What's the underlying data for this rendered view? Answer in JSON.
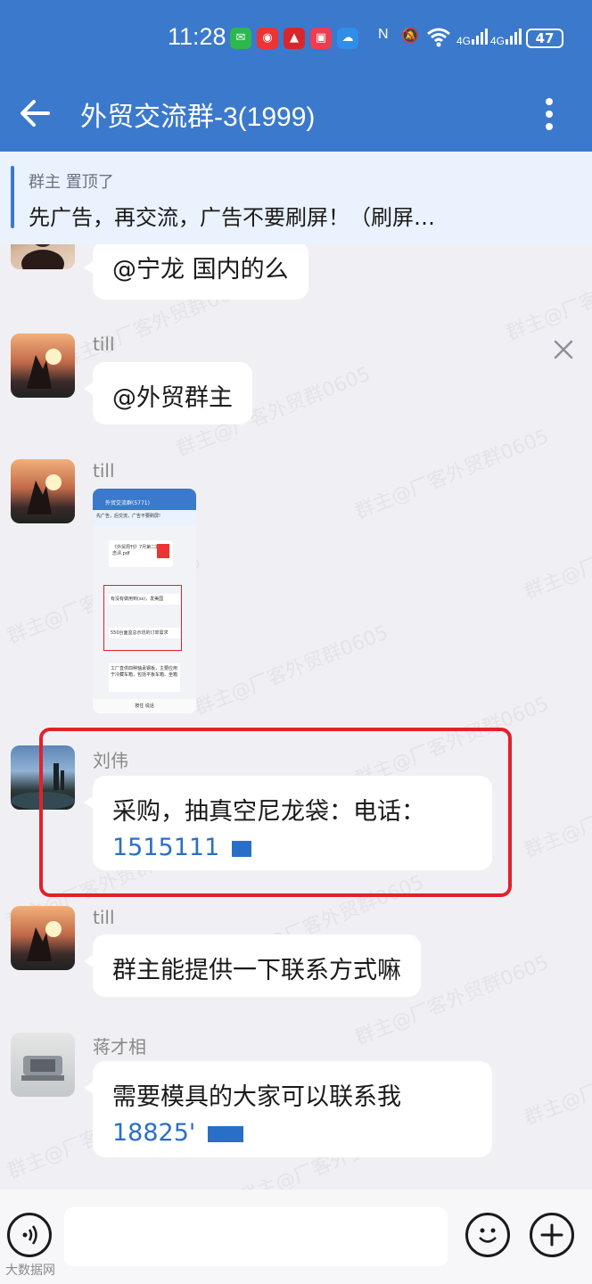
{
  "status_bar": {
    "time": "11:28",
    "battery": "47",
    "network_1": "4G",
    "network_2": "4G"
  },
  "header": {
    "title": "外贸交流群-3(1999)"
  },
  "pinned": {
    "meta": "群主 置顶了",
    "text": "先广告，再交流，广告不要刷屏！（刷屏…"
  },
  "watermark_text": "群主@厂客外贸群0605",
  "messages": [
    {
      "sender": "",
      "text": "@宁龙 国内的么"
    },
    {
      "sender": "till",
      "text": "@外贸群主"
    },
    {
      "sender": "till",
      "type": "image"
    },
    {
      "sender": "刘伟",
      "text": "采购，抽真空尼龙袋：电话：",
      "phone": "1515111"
    },
    {
      "sender": "till",
      "text": "群主能提供一下联系方式嘛"
    },
    {
      "sender": "蒋才相",
      "text": "需要模具的大家可以联系我",
      "phone": "18825'"
    }
  ],
  "thumbnail": {
    "title": "外贸交流群(5771)",
    "pinned": "先广告，后交流，广告不要刷屏!",
    "file": "《外贸周刊》7月第二期-概念评.pdf",
    "msg1": "有没有做用到(ss)，发美国",
    "msg2": "550台面监总示坊的订单需求",
    "msg3": "工厂直供四种轴承钢板，主要应用于冷藏车箱，包括平板车箱、坐箱",
    "input": "按住 说话"
  },
  "footer_mark": "大数据网",
  "colors": {
    "header": "#3b79cc",
    "highlight": "#e0222a",
    "phone": "#2a6fc7"
  }
}
